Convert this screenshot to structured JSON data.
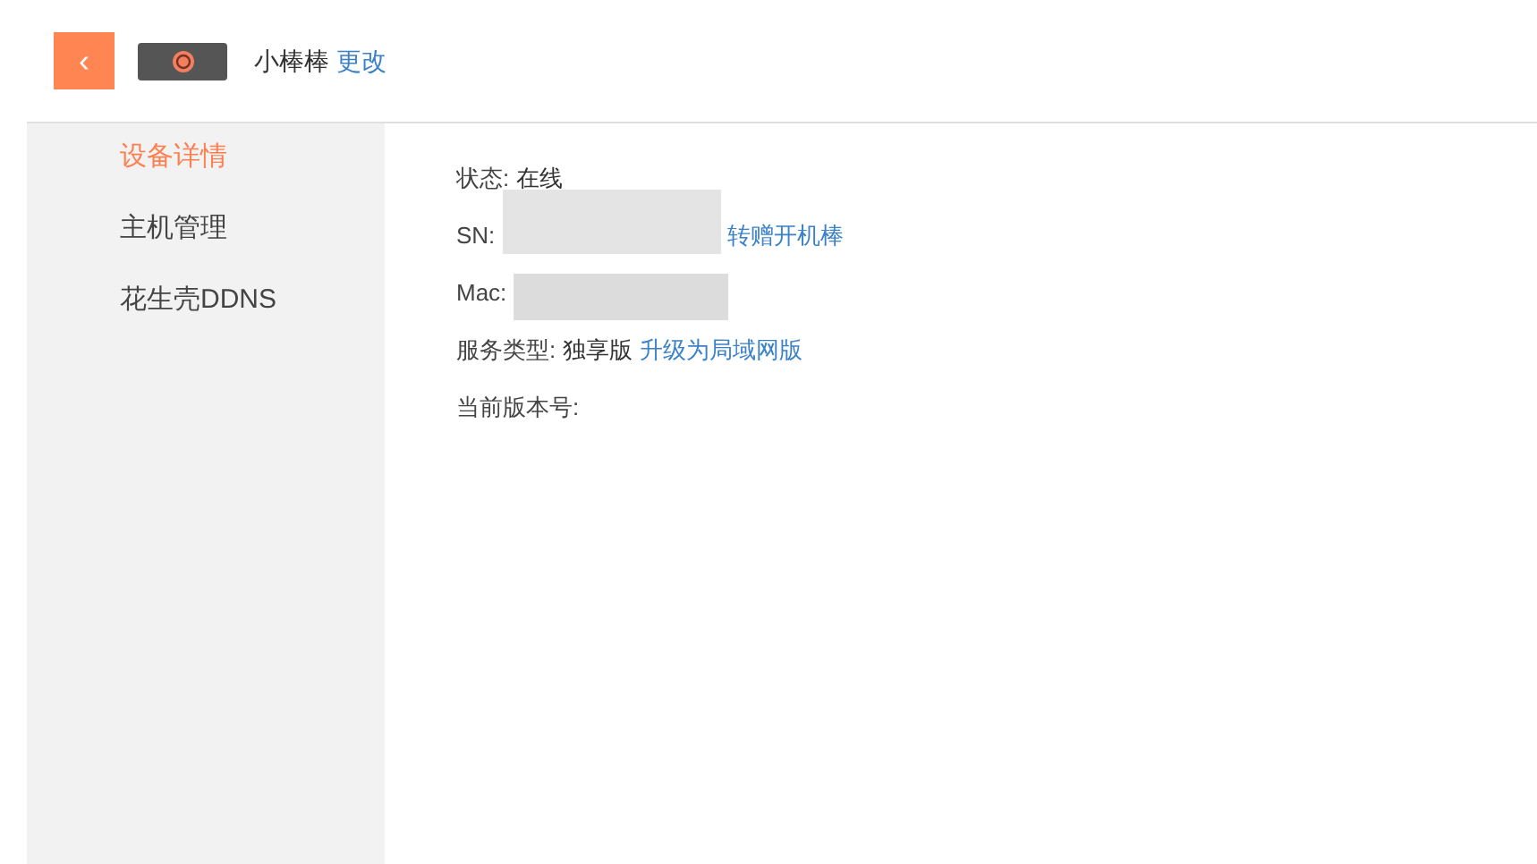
{
  "header": {
    "back_icon": "‹",
    "device_name": "小棒棒",
    "rename_link": "更改"
  },
  "sidebar": {
    "items": [
      {
        "label": "设备详情",
        "selected": true
      },
      {
        "label": "主机管理",
        "selected": false
      },
      {
        "label": "花生壳DDNS",
        "selected": false
      }
    ]
  },
  "details": [
    {
      "label": "状态:",
      "kind": "text",
      "value": "在线"
    },
    {
      "label": "SN:",
      "kind": "redacted",
      "link": "转赠开机棒"
    },
    {
      "label": "Mac:",
      "kind": "redacted"
    },
    {
      "label": "服务类型:",
      "kind": "text",
      "value": "独享版",
      "link": "升级为局域网版"
    },
    {
      "label": "当前版本号:",
      "kind": "text"
    }
  ]
}
